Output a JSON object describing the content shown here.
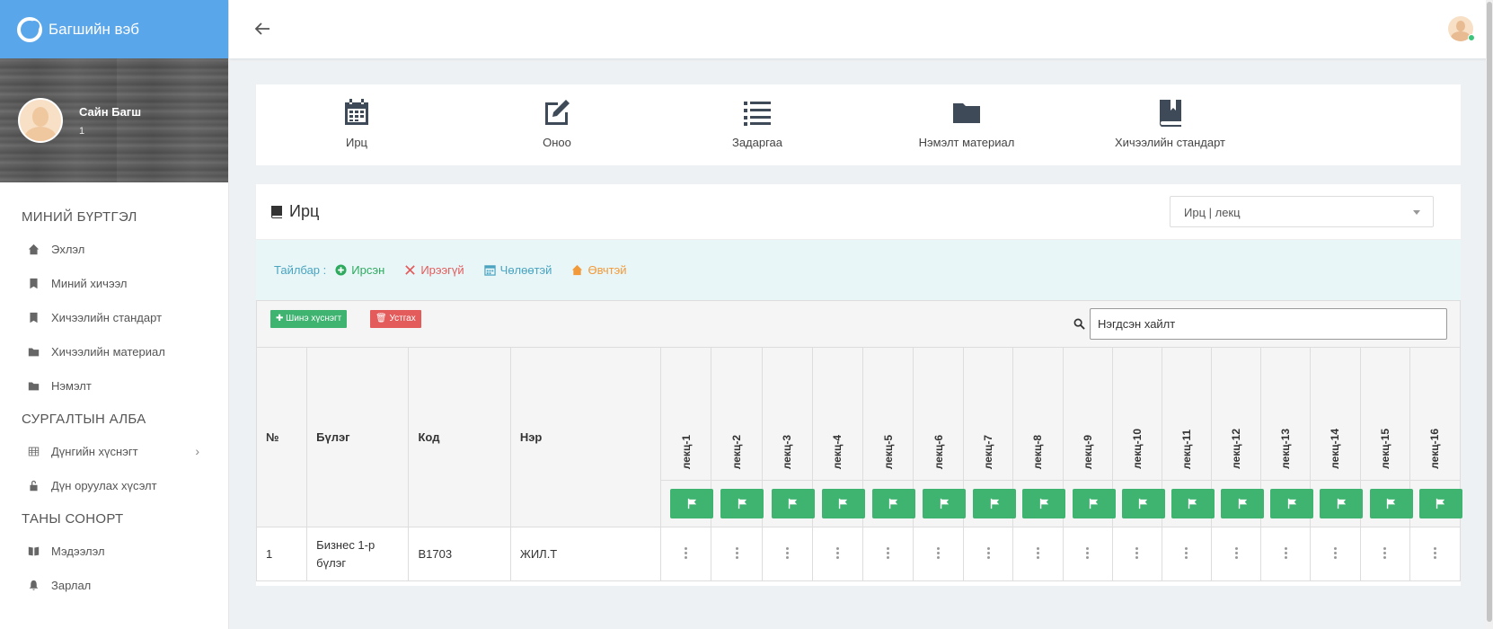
{
  "brand": {
    "title": "Багшийн вэб"
  },
  "profile": {
    "name": "Сайн Багш",
    "id": "1"
  },
  "menu": {
    "sections": [
      {
        "title": "МИНИЙ БҮРТГЭЛ",
        "items": [
          {
            "label": "Эхлэл",
            "icon": "home-icon"
          },
          {
            "label": "Миний хичээл",
            "icon": "book-icon"
          },
          {
            "label": "Хичээлийн стандарт",
            "icon": "book-icon"
          },
          {
            "label": "Хичээлийн материал",
            "icon": "folder-icon"
          },
          {
            "label": "Нэмэлт",
            "icon": "folder-icon"
          }
        ]
      },
      {
        "title": "СУРГАЛТЫН АЛБА",
        "items": [
          {
            "label": "Дүнгийн хүснэгт",
            "icon": "table-icon"
          },
          {
            "label": "Дүн оруулах хүсэлт",
            "icon": "unlock-icon"
          }
        ]
      },
      {
        "title": "ТАНЫ СОНОРТ",
        "items": [
          {
            "label": "Мэдээлэл",
            "icon": "open-book-icon"
          },
          {
            "label": "Зарлал",
            "icon": "bell-icon"
          }
        ]
      }
    ]
  },
  "quicknav": [
    {
      "label": "Ирц",
      "icon": "calendar-icon"
    },
    {
      "label": "Оноо",
      "icon": "edit-icon"
    },
    {
      "label": "Задаргаа",
      "icon": "list-icon"
    },
    {
      "label": "Нэмэлт материал",
      "icon": "folder-icon"
    },
    {
      "label": "Хичээлийн стандарт",
      "icon": "book-icon"
    }
  ],
  "panel": {
    "title": "Ирц",
    "select_value": "Ирц | лекц",
    "legend": {
      "label": "Тайлбар :",
      "present": "Ирсэн",
      "absent": "Ирээгүй",
      "excused": "Чөлөөтэй",
      "sick": "Өвчтэй"
    },
    "add_button": "Шинэ хүснэгт",
    "delete_button": "Устгах",
    "search_placeholder": "Нэгдсэн хайлт",
    "columns": {
      "no": "№",
      "group": "Бүлэг",
      "code": "Код",
      "name": "Нэр"
    },
    "lectures": [
      "лекц-1",
      "лекц-2",
      "лекц-3",
      "лекц-4",
      "лекц-5",
      "лекц-6",
      "лекц-7",
      "лекц-8",
      "лекц-9",
      "лекц-10",
      "лекц-11",
      "лекц-12",
      "лекц-13",
      "лекц-14",
      "лекц-15",
      "лекц-16"
    ],
    "rows": [
      {
        "no": "1",
        "group": "Бизнес 1-р бүлэг",
        "code": "B1703",
        "name": "ЖИЛ.Т"
      }
    ]
  },
  "colors": {
    "brand": "#5aa6ea",
    "green": "#3fb370",
    "red": "#e45b5b",
    "legend_bg": "#e8f6f8"
  }
}
